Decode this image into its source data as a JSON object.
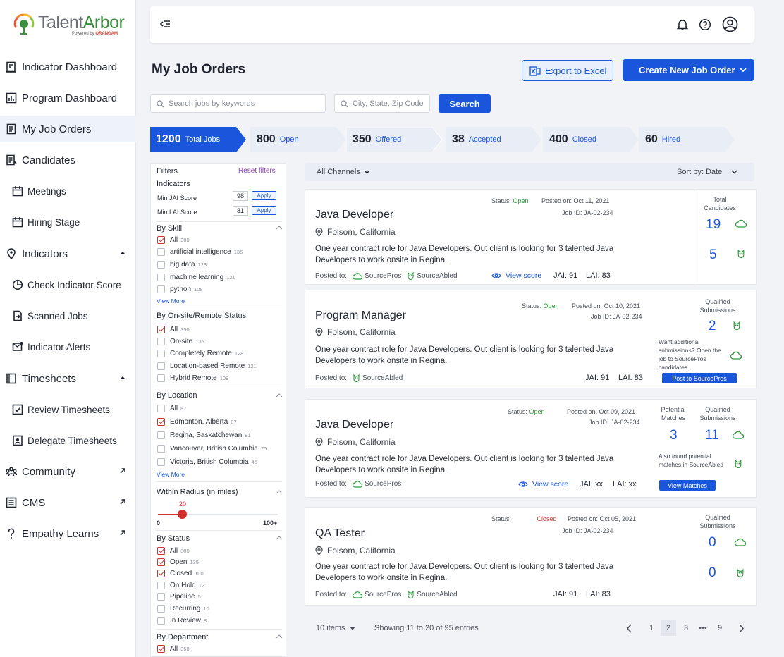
{
  "brand": {
    "name_a": "Talent",
    "name_b": "Arbor",
    "sub_a": "Powered by",
    "sub_b": "ORANGAM"
  },
  "sidebar": {
    "items": [
      {
        "label": "Indicator Dashboard"
      },
      {
        "label": "Program Dashboard"
      },
      {
        "label": "My Job Orders"
      },
      {
        "label": "Candidates"
      },
      {
        "label": "Meetings"
      },
      {
        "label": "Hiring Stage"
      },
      {
        "label": "Indicators"
      },
      {
        "label": "Check Indicator Score"
      },
      {
        "label": "Scanned Jobs"
      },
      {
        "label": "Indicator Alerts"
      },
      {
        "label": "Timesheets"
      },
      {
        "label": "Review Timesheets"
      },
      {
        "label": "Delegate Timesheets"
      },
      {
        "label": "Community"
      },
      {
        "label": "CMS"
      },
      {
        "label": "Empathy Learns"
      }
    ]
  },
  "page": {
    "title": "My Job Orders",
    "export_label": "Export to Excel",
    "create_label": "Create New Job Order"
  },
  "search": {
    "keywords_placeholder": "Search jobs by keywords",
    "location_placeholder": "City, State, Zip Code",
    "button": "Search"
  },
  "stages": [
    {
      "count": "1200",
      "label": "Total Jobs"
    },
    {
      "count": "800",
      "label": "Open"
    },
    {
      "count": "350",
      "label": "Offered"
    },
    {
      "count": "38",
      "label": "Accepted"
    },
    {
      "count": "400",
      "label": "Closed"
    },
    {
      "count": "60",
      "label": "Hired"
    }
  ],
  "filters": {
    "title": "Filters",
    "reset": "Reset filters",
    "indicators_title": "Indicators",
    "min_jai_label": "Min JAI Score",
    "min_jai_value": "98",
    "min_lai_label": "Min LAI Score",
    "min_lai_value": "81",
    "apply": "Apply",
    "view_more": "View More",
    "skill": {
      "title": "By Skill",
      "items": [
        {
          "label": "All",
          "count": "300"
        },
        {
          "label": "artificial intelligence",
          "count": "135"
        },
        {
          "label": "big data",
          "count": "128"
        },
        {
          "label": "machine learning",
          "count": "121"
        },
        {
          "label": "python",
          "count": "108"
        }
      ]
    },
    "onsite": {
      "title": "By On-site/Remote Status",
      "items": [
        {
          "label": "All",
          "count": "350"
        },
        {
          "label": "On-site",
          "count": "135"
        },
        {
          "label": "Completely Remote",
          "count": "128"
        },
        {
          "label": "Location-based Remote",
          "count": "121"
        },
        {
          "label": "Hybrid Remote",
          "count": "108"
        }
      ]
    },
    "location": {
      "title": "By Location",
      "items": [
        {
          "label": "All",
          "count": "87"
        },
        {
          "label": "Edmonton, Alberta",
          "count": "87"
        },
        {
          "label": "Regina, Saskatchewan",
          "count": "81"
        },
        {
          "label": "Vancouver, British Columbia",
          "count": "75"
        },
        {
          "label": "Victoria, British Columbia",
          "count": "45"
        }
      ]
    },
    "radius": {
      "title": "Within Radius (in miles)",
      "value": "20",
      "min": "0",
      "max": "100+",
      "fraction": 0.2
    },
    "status": {
      "title": "By Status",
      "items": [
        {
          "label": "All",
          "count": "300"
        },
        {
          "label": "Open",
          "count": "135"
        },
        {
          "label": "Closed",
          "count": "100"
        },
        {
          "label": "On Hold",
          "count": "12"
        },
        {
          "label": "Pipeline",
          "count": "5"
        },
        {
          "label": "Recurring",
          "count": "10"
        },
        {
          "label": "In Review",
          "count": "8"
        }
      ]
    },
    "department": {
      "title": "By Department",
      "items": [
        {
          "label": "All",
          "count": "350"
        }
      ]
    }
  },
  "channels": {
    "label": "All Channels",
    "sort": "Sort by: Date"
  },
  "jobs": [
    {
      "title": "Java Developer",
      "location": "Folsom, California",
      "desc": "One year contract role for Java Developers. Out client is looking for 3 talented Java Developers to work onsite in Regina.",
      "status_label": "Status:",
      "status": "Open",
      "posted": "Posted on: Oct 11, 2021",
      "job_id": "Job ID: JA-02-234",
      "posted_to": "Posted to:",
      "source_a": "SourcePros",
      "source_b": "SourceAbled",
      "view_score": "View score",
      "jai": "JAI: 91",
      "lai": "LAI: 83",
      "right_label": "Total Candidates",
      "num_a": "19",
      "num_b": "5"
    },
    {
      "title": "Program Manager",
      "location": "Folsom, California",
      "desc": "One year contract role for Java Developers. Out client is looking for 3 talented Java Developers to work onsite in Regina.",
      "status_label": "Status:",
      "status": "Open",
      "posted": "Posted on: Oct 10, 2021",
      "job_id": "Job ID: JA-02-234",
      "posted_to": "Posted to:",
      "source_b": "SourceAbled",
      "jai": "JAI: 91",
      "lai": "LAI: 83",
      "right_label": "Qualified Submissions",
      "num_a": "2",
      "want_text": "Want additional submissions? Open the job to SourcePros candidates.",
      "button": "Post to SourcePros"
    },
    {
      "title": "Java Developer",
      "location": "Folsom, California",
      "desc": "One year contract role for Java Developers. Out client is looking for 3 talented Java Developers to work onsite in Regina.",
      "status_label": "Status:",
      "status": "Open",
      "posted": "Posted on: Oct 09, 2021",
      "job_id": "Job ID: JA-02-234",
      "posted_to": "Posted to:",
      "source_a": "SourcePros",
      "view_score": "View score",
      "jai": "JAI: xx",
      "lai": "LAI: xx",
      "right_label_a": "Potential Matches",
      "right_label_b": "Qualified Submissions",
      "num_a": "3",
      "num_b": "11",
      "found_text": "Also found potential matches in SourceAbled",
      "button": "View Matches"
    },
    {
      "title": "QA Tester",
      "location": "Folsom, California",
      "desc": "One year contract role for Java Developers. Out client is looking for 3 talented Java Developers to work onsite in Regina.",
      "status_label": "Status:",
      "status": "Closed",
      "posted": "Posted on: Oct 05, 2021",
      "job_id": "Job ID: JA-02-234",
      "posted_to": "Posted to:",
      "source_a": "SourcePros",
      "source_b": "SourceAbled",
      "jai": "JAI: 91",
      "lai": "LAI: 83",
      "right_label": "Qualified Submissions",
      "num_a": "0",
      "num_b": "0"
    }
  ],
  "pagination": {
    "per_page": "10 items",
    "showing": "Showing 11 to 20 of 95 entries",
    "pages": [
      "1",
      "2",
      "3",
      "•••",
      "9"
    ],
    "current": "2"
  },
  "colors": {
    "primary": "#1a56db",
    "green": "#2f9a3b",
    "red": "#d0312d"
  }
}
